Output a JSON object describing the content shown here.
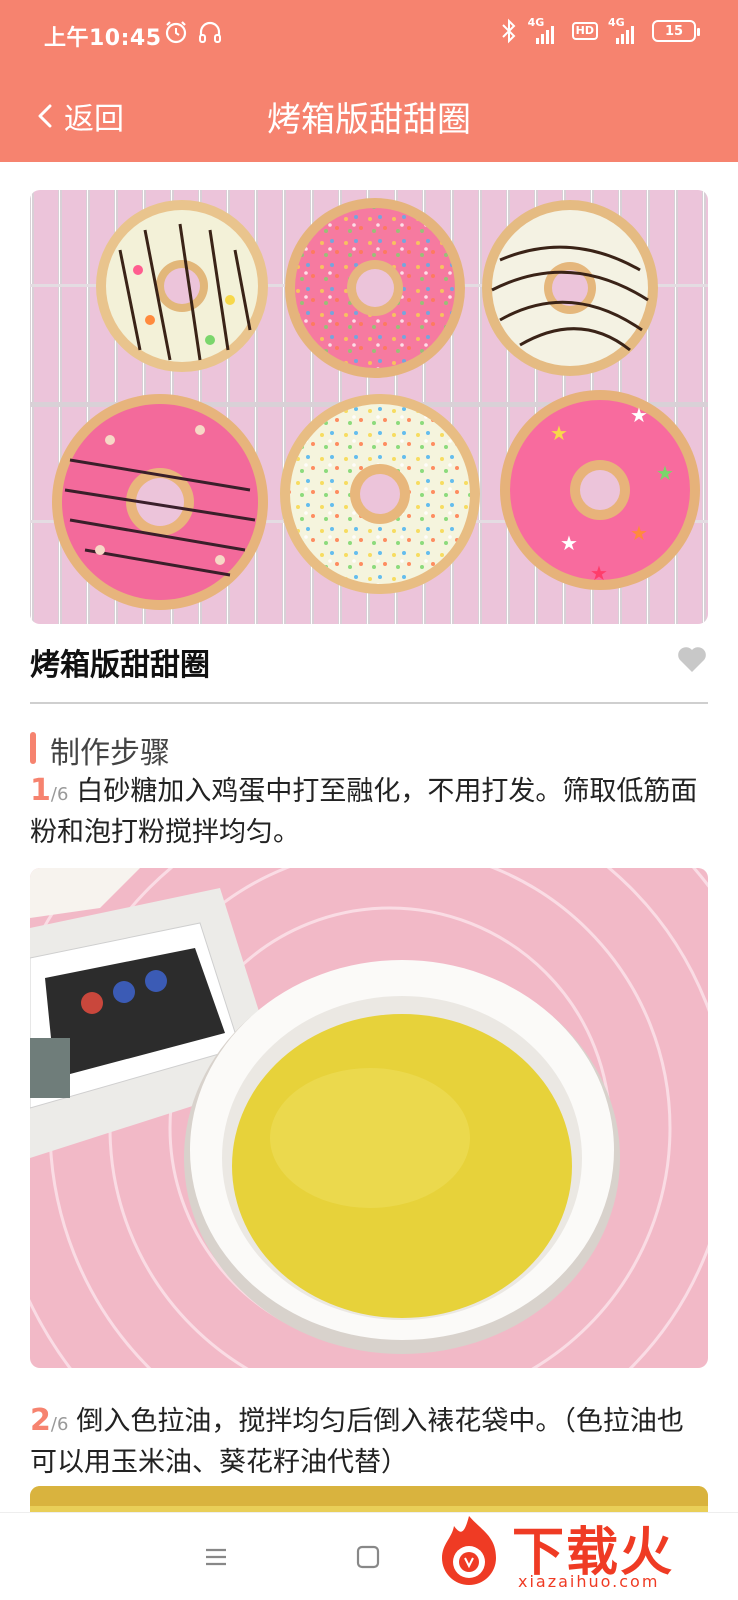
{
  "status_bar": {
    "time": "上午10:45",
    "net1": "4G",
    "hd": "HD",
    "net2": "4G",
    "battery": "15"
  },
  "nav": {
    "back_label": "返回",
    "title": "烤箱版甜甜圈"
  },
  "recipe": {
    "title": "烤箱版甜甜圈",
    "section_title": "制作步骤",
    "steps": [
      {
        "num": "1",
        "total": "/6",
        "text": "白砂糖加入鸡蛋中打至融化，不用打发。筛取低筋面粉和泡打粉搅拌均匀。"
      },
      {
        "num": "2",
        "total": "/6",
        "text": "倒入色拉油，搅拌均匀后倒入裱花袋中。（色拉油也可以用玉米油、葵花籽油代替）"
      }
    ]
  },
  "watermark": {
    "brand": "下载火",
    "domain": "xiazaihuo.com"
  },
  "colors": {
    "accent": "#f6836f",
    "watermark": "#ef3b24"
  },
  "icons": {
    "alarm": "alarm-icon",
    "headset": "headset-icon",
    "bluetooth": "bluetooth-icon",
    "back": "chevron-left-icon",
    "favorite": "heart-icon",
    "menu": "menu-icon",
    "home": "home-square-icon"
  }
}
